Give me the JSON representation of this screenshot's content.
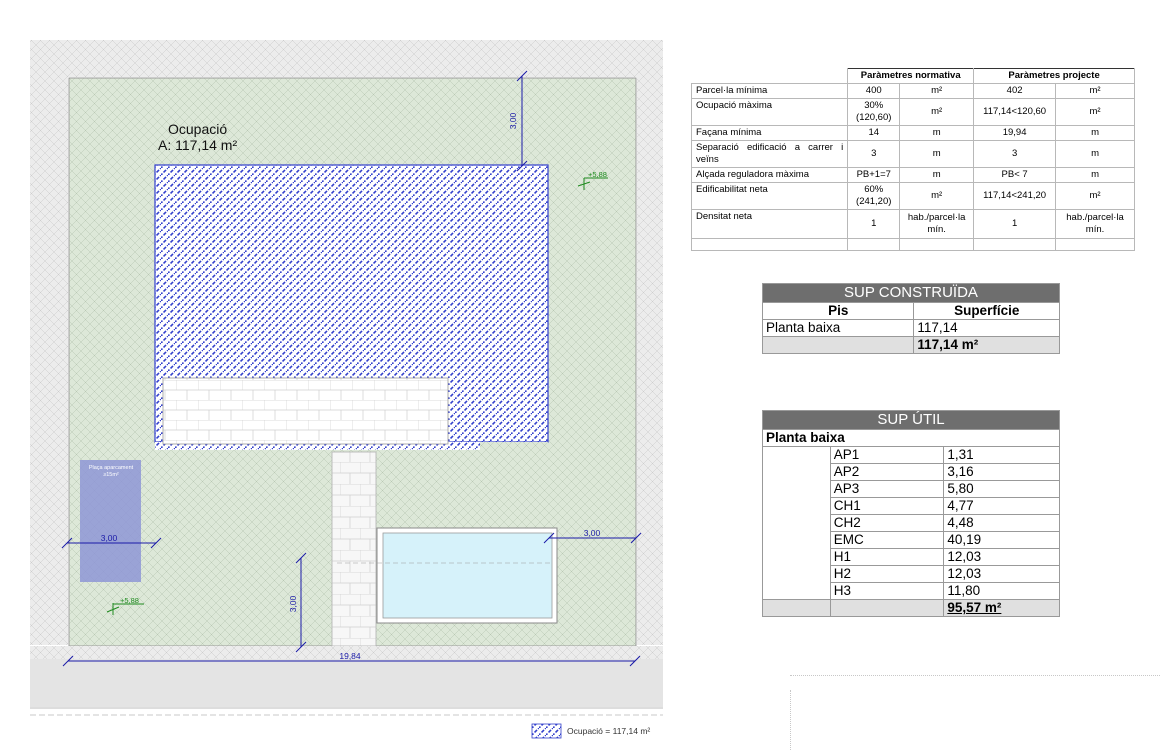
{
  "plan": {
    "occupation_label": "Ocupació",
    "occupation_area": "A: 117,14 m²",
    "dim_top": "3,00",
    "dim_left": "3,00",
    "dim_right": "3,00",
    "dim_bottom": "3,00",
    "dim_width": "19,84",
    "level_1": "+5,88",
    "level_2": "+5,88",
    "parking_label": "Plaça aparcament",
    "parking_area": "≥15m²",
    "legend_label": "Ocupació = 117,14 m²",
    "colors": {
      "garden": "#dde8d8",
      "hatch": "#3340cc",
      "dimension": "#1a1aa8",
      "level": "#1e8a1e",
      "pool": "#d6f2fa",
      "parking": "#8e97d6",
      "street": "#e4e4e4"
    }
  },
  "params_table": {
    "header_normativa": "Paràmetres normativa",
    "header_projecte": "Paràmetres projecte",
    "rows": [
      {
        "label": "Parcel·la mínima",
        "norm": "400",
        "norm_unit": "m²",
        "proj": "402",
        "proj_unit": "m²"
      },
      {
        "label": "Ocupació màxima",
        "norm": "30% (120,60)",
        "norm_unit": "m²",
        "proj": "117,14<120,60",
        "proj_unit": "m²"
      },
      {
        "label": "Façana mínima",
        "norm": "14",
        "norm_unit": "m",
        "proj": "19,94",
        "proj_unit": "m"
      },
      {
        "label": "Separació edificació a carrer i veïns",
        "norm": "3",
        "norm_unit": "m",
        "proj": "3",
        "proj_unit": "m"
      },
      {
        "label": "Alçada reguladora màxima",
        "norm": "PB+1=7",
        "norm_unit": "m",
        "proj": "PB< 7",
        "proj_unit": "m"
      },
      {
        "label": "Edificabilitat neta",
        "norm": "60% (241,20)",
        "norm_unit": "m²",
        "proj": "117,14<241,20",
        "proj_unit": "m²"
      },
      {
        "label": "Densitat neta",
        "norm": "1",
        "norm_unit": "hab./parcel·la mín.",
        "proj": "1",
        "proj_unit": "hab./parcel·la mín."
      }
    ]
  },
  "sup_construida": {
    "title": "SUP CONSTRUÏDA",
    "col_pis": "Pis",
    "col_superficie": "Superfície",
    "row_label": "Planta baixa",
    "row_value": "117,14",
    "total": "117,14 m²"
  },
  "sup_util": {
    "title": "SUP ÚTIL",
    "floor": "Planta baixa",
    "rooms": [
      {
        "name": "AP1",
        "value": "1,31"
      },
      {
        "name": "AP2",
        "value": "3,16"
      },
      {
        "name": "AP3",
        "value": "5,80"
      },
      {
        "name": "CH1",
        "value": "4,77"
      },
      {
        "name": "CH2",
        "value": "4,48"
      },
      {
        "name": "EMC",
        "value": "40,19"
      },
      {
        "name": "H1",
        "value": "12,03"
      },
      {
        "name": "H2",
        "value": "12,03"
      },
      {
        "name": "H3",
        "value": "11,80"
      }
    ],
    "total": "95,57 m²"
  }
}
